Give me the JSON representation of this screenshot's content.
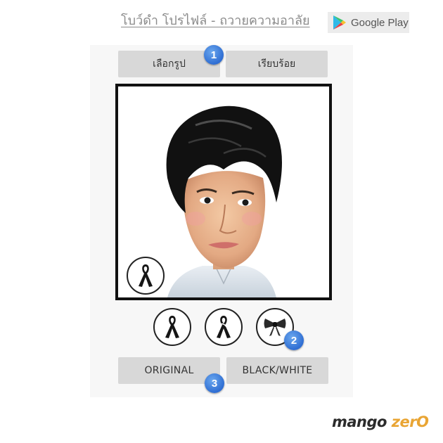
{
  "header": {
    "title_link": "โบว์ดำ โปรไฟล์ - ถวายความอาลัย",
    "store_badge": {
      "label": "Google Play",
      "icon": "google-play-icon"
    }
  },
  "app": {
    "top_buttons": [
      {
        "label": "เลือกรูป"
      },
      {
        "label": "เรียบร้อย"
      }
    ],
    "preview": {
      "image": "caricature-portrait",
      "overlay_icon": "black-ribbon-icon"
    },
    "ribbon_options": [
      {
        "icon": "black-ribbon-icon"
      },
      {
        "icon": "black-ribbon-white-outline-icon"
      },
      {
        "icon": "black-bow-icon"
      }
    ],
    "filter_buttons": [
      {
        "label": "ORIGINAL"
      },
      {
        "label": "BLACK/WHITE"
      }
    ],
    "step_badges": [
      "1",
      "2",
      "3"
    ],
    "colors": {
      "button_bg": "#d8d8d8",
      "panel_bg": "#f7f7f7",
      "badge_blue": "#2f6ed3"
    }
  },
  "branding": {
    "part1": "mango",
    "part2": "zer",
    "part3": "O",
    "accent": "#e9a534"
  }
}
